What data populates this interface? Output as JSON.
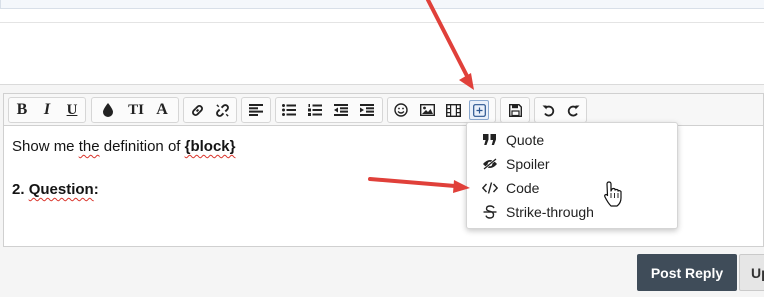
{
  "toolbar": {
    "buttons": [
      {
        "name": "bold",
        "icon": "bold-icon"
      },
      {
        "name": "italic",
        "icon": "italic-icon"
      },
      {
        "name": "underline",
        "icon": "underline-icon"
      },
      {
        "name": "text-color",
        "icon": "droplet-icon"
      },
      {
        "name": "font-size",
        "icon": "text-height-icon"
      },
      {
        "name": "font-family",
        "icon": "font-icon"
      },
      {
        "name": "insert-link",
        "icon": "link-icon"
      },
      {
        "name": "remove-link",
        "icon": "unlink-icon"
      },
      {
        "name": "align",
        "icon": "align-left-icon"
      },
      {
        "name": "bullet-list",
        "icon": "list-ul-icon"
      },
      {
        "name": "numbered-list",
        "icon": "list-ol-icon"
      },
      {
        "name": "outdent",
        "icon": "outdent-icon"
      },
      {
        "name": "indent",
        "icon": "indent-icon"
      },
      {
        "name": "smilies",
        "icon": "smile-icon"
      },
      {
        "name": "insert-image",
        "icon": "image-icon"
      },
      {
        "name": "insert-media",
        "icon": "film-icon"
      },
      {
        "name": "insert",
        "icon": "plus-square-icon"
      },
      {
        "name": "drafts",
        "icon": "save-icon"
      },
      {
        "name": "undo",
        "icon": "undo-icon"
      },
      {
        "name": "redo",
        "icon": "redo-icon"
      }
    ],
    "text_glyphs": {
      "bold": "B",
      "italic": "I",
      "underline": "U",
      "font_size": "TI",
      "font_family": "A"
    }
  },
  "editor": {
    "line1_prefix": "Show me ",
    "line1_squiggle": "the",
    "line1_mid": " definition of ",
    "line1_bold": "{block}",
    "line2_number": "2. ",
    "line2_squiggle": "Question",
    "line2_suffix": ":"
  },
  "insert_menu": {
    "items": [
      {
        "label": "Quote",
        "icon": "quote-icon"
      },
      {
        "label": "Spoiler",
        "icon": "eye-slash-icon"
      },
      {
        "label": "Code",
        "icon": "code-icon"
      },
      {
        "label": "Strike-through",
        "icon": "strikethrough-icon"
      }
    ]
  },
  "actions": {
    "post_reply": "Post Reply",
    "second_button_partial": "Up"
  },
  "colors": {
    "annotation_arrow": "#e0403a",
    "post_button": "#3f4c59"
  }
}
